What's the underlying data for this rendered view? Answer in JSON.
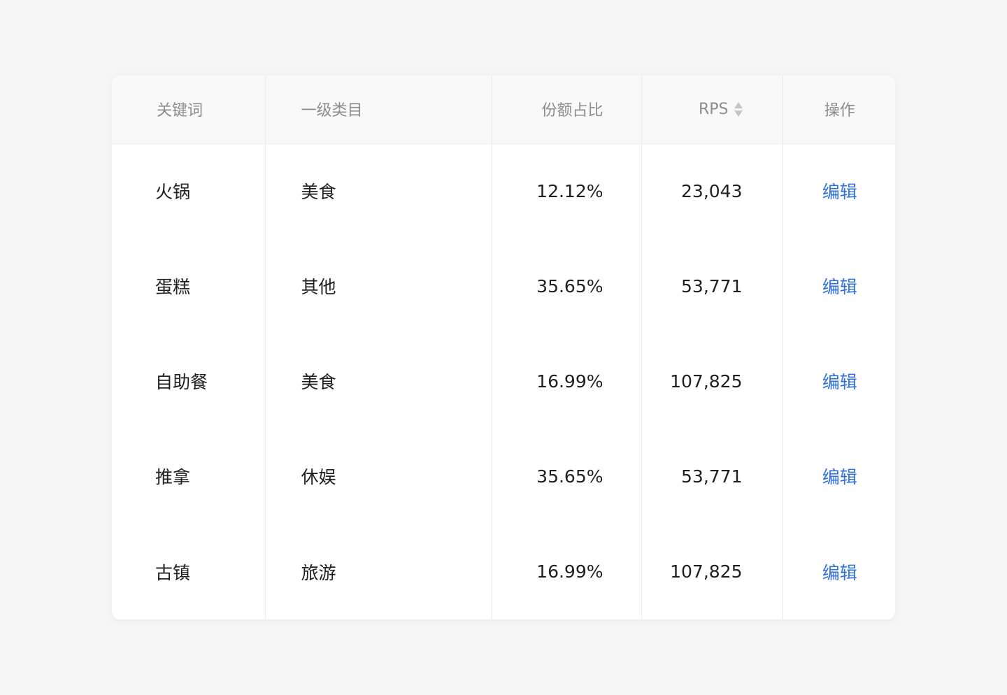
{
  "table": {
    "headers": {
      "keyword": "关键词",
      "category": "一级类目",
      "share": "份额占比",
      "rps": "RPS",
      "action": "操作"
    },
    "rows": [
      {
        "keyword": "火锅",
        "category": "美食",
        "share": "12.12%",
        "rps": "23,043",
        "action": "编辑"
      },
      {
        "keyword": "蛋糕",
        "category": "其他",
        "share": "35.65%",
        "rps": "53,771",
        "action": "编辑"
      },
      {
        "keyword": "自助餐",
        "category": "美食",
        "share": "16.99%",
        "rps": "107,825",
        "action": "编辑"
      },
      {
        "keyword": "推拿",
        "category": "休娱",
        "share": "35.65%",
        "rps": "53,771",
        "action": "编辑"
      },
      {
        "keyword": "古镇",
        "category": "旅游",
        "share": "16.99%",
        "rps": "107,825",
        "action": "编辑"
      }
    ]
  },
  "icons": {
    "sort": "sort-icon"
  },
  "colors": {
    "link": "#2f6fe0",
    "header_text": "#8c8c8c",
    "body_text": "#1f1f1f",
    "header_bg": "#f9f9f9",
    "page_bg": "#f6f6f6"
  }
}
